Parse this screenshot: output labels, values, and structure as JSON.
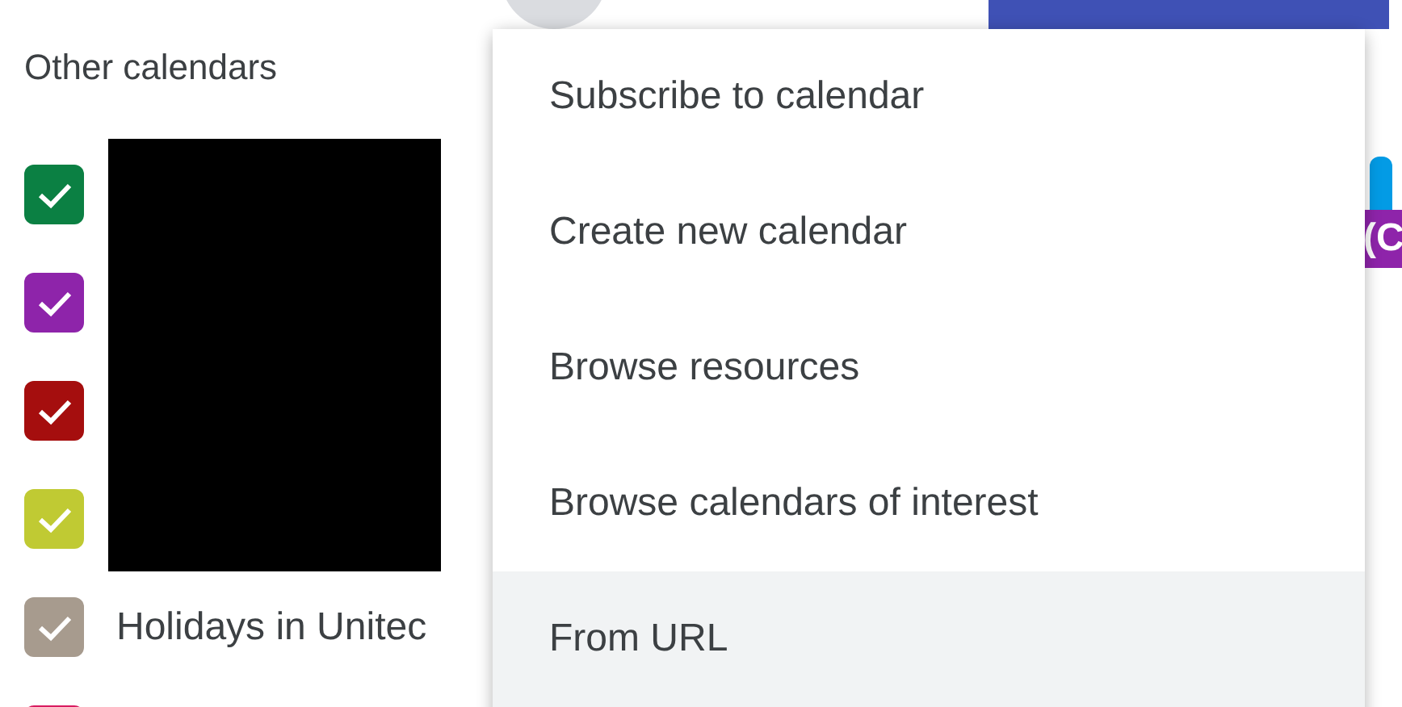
{
  "sidebar": {
    "heading": "Other calendars",
    "calendars": [
      {
        "color": "#0b8043",
        "checked": true
      },
      {
        "color": "#8e24aa",
        "checked": true
      },
      {
        "color": "#a50e0e",
        "checked": true
      },
      {
        "color": "#c0ca33",
        "checked": true
      },
      {
        "color": "#a79b8e",
        "checked": true,
        "label": "Holidays in Unitec"
      },
      {
        "color": "#d81b60"
      }
    ]
  },
  "event_chips": [
    {
      "color": "#3f51b5"
    },
    {
      "color": "#039be5"
    },
    {
      "color": "#8e24aa",
      "label": "(C"
    }
  ],
  "menu": {
    "items": [
      {
        "label": "Subscribe to calendar",
        "highlighted": false
      },
      {
        "label": "Create new calendar",
        "highlighted": false
      },
      {
        "label": "Browse resources",
        "highlighted": false
      },
      {
        "label": "Browse calendars of interest",
        "highlighted": false
      },
      {
        "label": "From URL",
        "highlighted": true
      }
    ]
  }
}
